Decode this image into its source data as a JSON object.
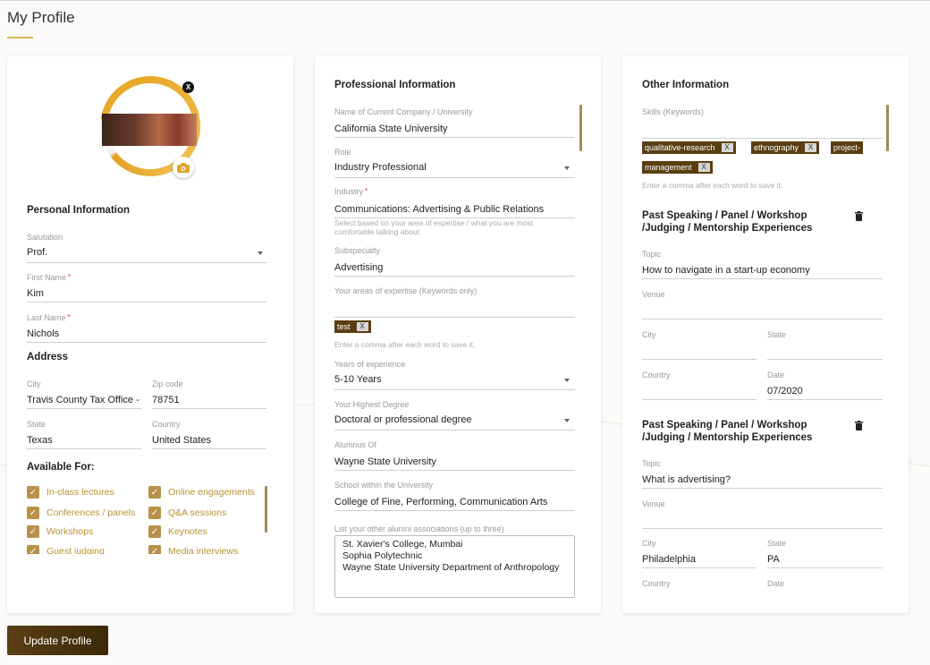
{
  "page": {
    "title": "My Profile"
  },
  "left": {
    "personal_title": "Personal Information",
    "salutation": {
      "label": "Salutation",
      "value": "Prof."
    },
    "first_name": {
      "label": "First Name",
      "value": "Kim"
    },
    "last_name": {
      "label": "Last Name",
      "value": "Nichols"
    },
    "address_title": "Address",
    "city": {
      "label": "City",
      "value": "Travis County Tax Office - M"
    },
    "zip": {
      "label": "Zip code",
      "value": "78751"
    },
    "state": {
      "label": "State",
      "value": "Texas"
    },
    "country": {
      "label": "Country",
      "value": "United States"
    },
    "available_title": "Available For:",
    "available": [
      "In-class lectures",
      "Online engagements",
      "Conferences / panels",
      "Q&A sessions",
      "Workshops",
      "Keynotes",
      "Guest judging",
      "Media interviews"
    ]
  },
  "mid": {
    "title": "Professional Information",
    "company": {
      "label": "Name of Current Company / University",
      "value": "California State University"
    },
    "role": {
      "label": "Role",
      "value": "Industry Professional"
    },
    "industry": {
      "label": "Industry",
      "value": "Communications: Advertising & Public Relations",
      "hint_1": "Select based on your area of expertise / what you are most",
      "hint_2": "comfortable talking about"
    },
    "subspecialty": {
      "label": "Subspecialty",
      "value": "Advertising"
    },
    "expertise": {
      "label": "Your areas of expertise (Keywords only)",
      "tags": [
        "test"
      ],
      "hint": "Enter a comma after each word to save it."
    },
    "years": {
      "label": "Years of experience",
      "value": "5-10 Years"
    },
    "degree": {
      "label": "Your Highest Degree",
      "value": "Doctoral or professional degree"
    },
    "alumnus": {
      "label": "Alumnus Of",
      "value": "Wayne State University"
    },
    "school": {
      "label": "School within the University",
      "value": "College of Fine, Performing, Communication Arts"
    },
    "other_alumni": {
      "label": "List your other alumni associations (up to three)",
      "lines": [
        "St. Xavier's College, Mumbai",
        "Sophia Polytechnic",
        "Wayne State University Department of Anthropology"
      ]
    }
  },
  "right": {
    "title": "Other Information",
    "skills": {
      "label": "Skills (Keywords)",
      "tags": [
        "qualitative-research",
        "ethnography",
        "project-",
        "management"
      ],
      "hint": "Enter a comma after each word to save it."
    },
    "exp_title_1": "Past Speaking / Panel / Workshop",
    "exp_title_2": "/Judging / Mentorship Experiences",
    "labels": {
      "topic": "Topic",
      "venue": "Venue",
      "city": "City",
      "state": "State",
      "country": "Country",
      "date": "Date"
    },
    "exp1": {
      "topic": "How to navigate in a start-up economy",
      "venue": "",
      "city": "",
      "state": "",
      "country": "",
      "date": "07/2020"
    },
    "exp2": {
      "topic": "What is advertising?",
      "venue": "",
      "city": "Philadelphia",
      "state": "PA"
    }
  },
  "update_label": "Update Profile",
  "icons": {
    "close": "X"
  },
  "colors": {
    "accent": "#b8914a",
    "tag_bg": "#5a3e12",
    "button": "#4a3210"
  }
}
